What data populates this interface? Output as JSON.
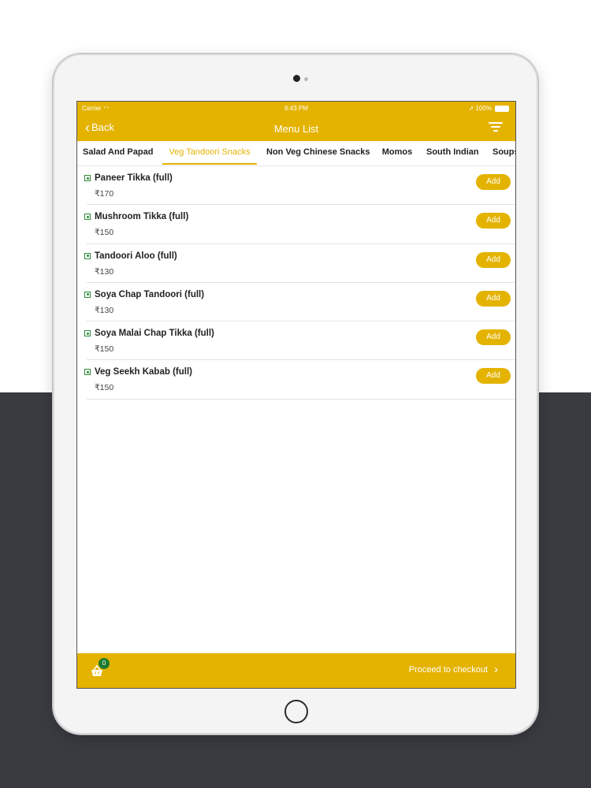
{
  "status_bar": {
    "carrier": "Carrier",
    "time": "6:43 PM",
    "battery": "100%"
  },
  "nav": {
    "back_label": "Back",
    "title": "Menu List"
  },
  "tabs": [
    {
      "label": "Salad And Papad",
      "active": false
    },
    {
      "label": "Veg Tandoori Snacks",
      "active": true
    },
    {
      "label": "Non Veg Chinese Snacks",
      "active": false
    },
    {
      "label": "Momos",
      "active": false
    },
    {
      "label": "South Indian",
      "active": false
    },
    {
      "label": "Soups",
      "active": false
    }
  ],
  "menu_items": [
    {
      "name": "Paneer Tikka (full)",
      "price": "₹170",
      "add_label": "Add"
    },
    {
      "name": "Mushroom Tikka (full)",
      "price": "₹150",
      "add_label": "Add"
    },
    {
      "name": "Tandoori Aloo (full)",
      "price": "₹130",
      "add_label": "Add"
    },
    {
      "name": "Soya Chap Tandoori (full)",
      "price": "₹130",
      "add_label": "Add"
    },
    {
      "name": "Soya Malai Chap Tikka (full)",
      "price": "₹150",
      "add_label": "Add"
    },
    {
      "name": "Veg Seekh Kabab (full)",
      "price": "₹150",
      "add_label": "Add"
    }
  ],
  "bottom_bar": {
    "cart_count": "0",
    "checkout_label": "Proceed to checkout"
  },
  "colors": {
    "accent": "#e4b300",
    "veg_green": "#2e8b3a",
    "badge_green": "#1f7a2e",
    "background_dark": "#393b40"
  }
}
